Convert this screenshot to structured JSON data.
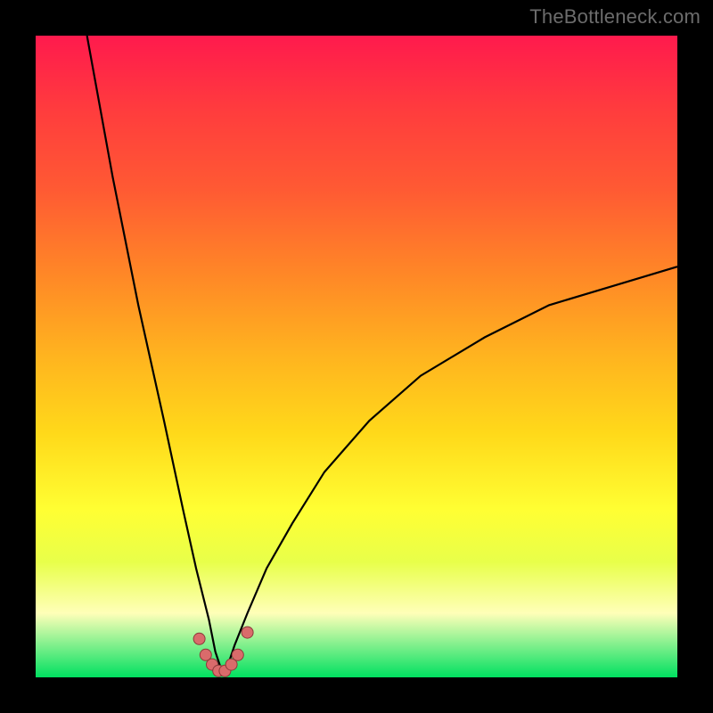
{
  "watermark": "TheBottleneck.com",
  "colors": {
    "gradient_top": "#ff1a4d",
    "gradient_bottom": "#00e060",
    "curve": "#000000",
    "dot_fill": "#d96b6b",
    "dot_stroke": "#8c3a3a",
    "frame_bg": "#000000"
  },
  "chart_data": {
    "type": "line",
    "title": "",
    "xlabel": "",
    "ylabel": "",
    "xlim": [
      0,
      100
    ],
    "ylim": [
      0,
      100
    ],
    "grid": false,
    "legend": false,
    "notes": "V-shaped bottleneck curve on rainbow gradient. Vertex near x≈29, y≈0. Left branch falls steeply from (≈8,100); right branch rises toward (100,≈64). Dots cluster near the minimum.",
    "series": [
      {
        "name": "bottleneck-curve",
        "x": [
          8,
          12,
          16,
          20,
          23,
          25,
          27,
          28,
          29,
          30,
          31,
          33,
          36,
          40,
          45,
          52,
          60,
          70,
          80,
          90,
          100
        ],
        "values": [
          100,
          78,
          58,
          40,
          26,
          17,
          9,
          4,
          1,
          2,
          5,
          10,
          17,
          24,
          32,
          40,
          47,
          53,
          58,
          61,
          64
        ]
      }
    ],
    "dots": [
      {
        "x": 25.5,
        "y": 6
      },
      {
        "x": 26.5,
        "y": 3.5
      },
      {
        "x": 27.5,
        "y": 2
      },
      {
        "x": 28.5,
        "y": 1
      },
      {
        "x": 29.5,
        "y": 1
      },
      {
        "x": 30.5,
        "y": 2
      },
      {
        "x": 31.5,
        "y": 3.5
      },
      {
        "x": 33.0,
        "y": 7
      }
    ]
  }
}
